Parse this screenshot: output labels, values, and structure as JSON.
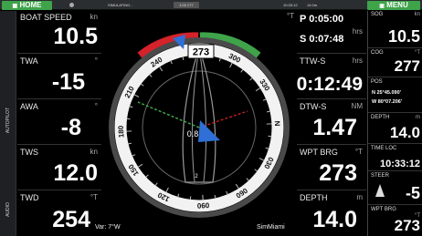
{
  "topbar": {
    "home_label": "HOME",
    "menu_label": "MENU",
    "sim_text": "SIMULATING...",
    "sim_indicator": "1:00 277",
    "time": "10:33:12",
    "range": "14.0m"
  },
  "side_tabs": {
    "autopilot": "AUTOPILOT",
    "audio": "AUDIO"
  },
  "left_cells": [
    {
      "label": "BOAT SPEED",
      "unit": "kn",
      "value": "10.5"
    },
    {
      "label": "TWA",
      "unit": "°",
      "value": "-15"
    },
    {
      "label": "AWA",
      "unit": "°",
      "value": "-8"
    },
    {
      "label": "TWS",
      "unit": "kn",
      "value": "12.0"
    },
    {
      "label": "TWD",
      "unit": "°T",
      "value": "254"
    }
  ],
  "race_timer": {
    "unit": "°T",
    "port_line": "P 0:05:00",
    "starboard_line": "S 0:07:48",
    "unit2": "hrs"
  },
  "mid_right_cells": [
    {
      "label": "TTW-S",
      "unit": "hrs",
      "value": "0:12:49"
    },
    {
      "label": "DTW-S",
      "unit": "NM",
      "value": "1.47"
    },
    {
      "label": "WPT BRG",
      "unit": "°T",
      "value": "273"
    },
    {
      "label": "DEPTH",
      "unit": "m",
      "value": "14.0"
    }
  ],
  "compass": {
    "heading": "273",
    "center_value": "0.8",
    "aft_value": "2",
    "labels": [
      "240",
      "300",
      "330",
      "N",
      "030",
      "060",
      "090",
      "120",
      "150",
      "180",
      "210",
      "W"
    ]
  },
  "footer": {
    "variation": "Var: 7°W",
    "source": "SimMiami"
  },
  "right_panel": {
    "sog": {
      "label": "SOG",
      "unit": "kn",
      "value": "10.5"
    },
    "cog": {
      "label": "COG",
      "unit": "°T",
      "value": "277"
    },
    "pos": {
      "label": "POS",
      "lat": "N  25°45.090'",
      "lon": "W  80°07.206'"
    },
    "depth": {
      "label": "DEPTH",
      "unit": "m",
      "value": "14.0"
    },
    "time": {
      "label": "TIME LOC",
      "value": "10:33:12"
    },
    "steer": {
      "label": "STEER",
      "value": "-5"
    },
    "wpt_brg": {
      "label": "WPT BRG",
      "unit": "°T",
      "value": "273"
    }
  },
  "colors": {
    "green": "#3fa34a",
    "red": "#d6222a",
    "blue": "#2f6fd6"
  }
}
